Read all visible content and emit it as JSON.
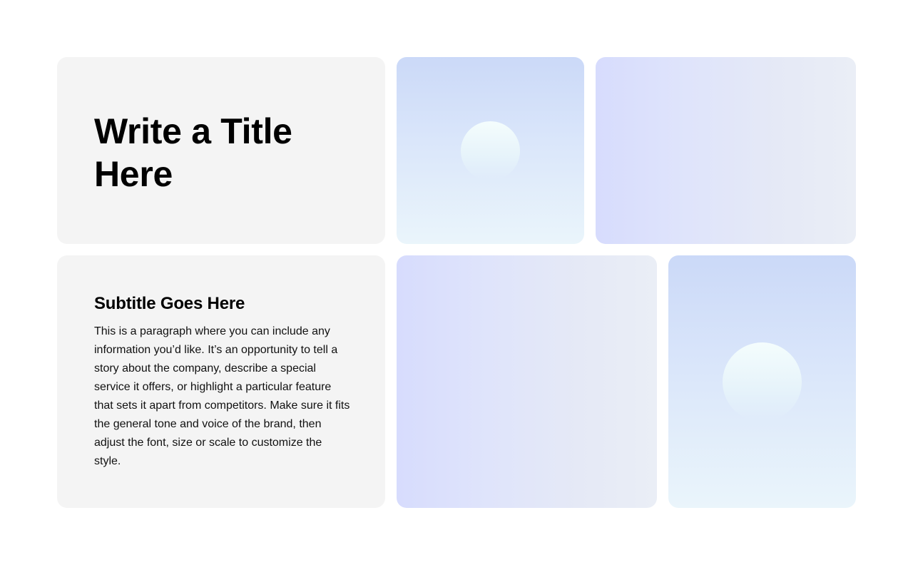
{
  "title_card": {
    "title": "Write a Title Here"
  },
  "body_card": {
    "subtitle": "Subtitle Goes Here",
    "paragraph": "This is a paragraph where you can include any information you’d like. It’s an opportunity to tell a story about the company, describe a special service it offers, or highlight a particular feature that sets it apart from competitors. Make sure it fits the general tone and voice of the brand, then adjust the font, size or scale to customize the style."
  },
  "images": [
    {
      "icon": "sun-placeholder-image",
      "orientation": "vertical"
    },
    {
      "icon": "gradient-placeholder-image",
      "orientation": "horizontal"
    },
    {
      "icon": "gradient-placeholder-image",
      "orientation": "horizontal"
    },
    {
      "icon": "sun-placeholder-image",
      "orientation": "vertical"
    }
  ],
  "colors": {
    "card_background": "#f4f4f4",
    "image_blue_top": "#cbd9f8",
    "image_blue_bottom": "#eaf5fb",
    "image_lavender": "#d7dcfd",
    "text": "#000000"
  }
}
